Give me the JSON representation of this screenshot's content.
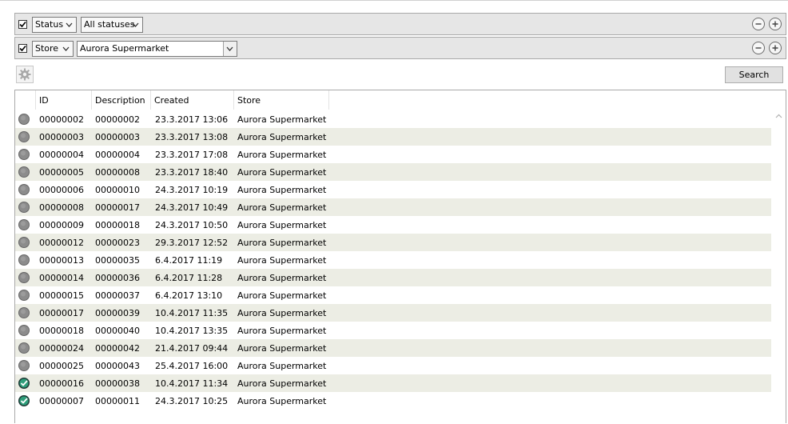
{
  "filters": [
    {
      "checked": true,
      "field": "Status",
      "value": "All statuses"
    },
    {
      "checked": true,
      "field": "Store",
      "value": "Aurora Supermarket"
    }
  ],
  "search": {
    "label": "Search"
  },
  "table": {
    "columns": [
      "ID",
      "Description",
      "Created",
      "Store"
    ],
    "rows": [
      {
        "status": "pending",
        "id": "00000002",
        "description": "00000002",
        "created": "23.3.2017 13:06",
        "store": "Aurora Supermarket"
      },
      {
        "status": "pending",
        "id": "00000003",
        "description": "00000003",
        "created": "23.3.2017 13:08",
        "store": "Aurora Supermarket"
      },
      {
        "status": "pending",
        "id": "00000004",
        "description": "00000004",
        "created": "23.3.2017 17:08",
        "store": "Aurora Supermarket"
      },
      {
        "status": "pending",
        "id": "00000005",
        "description": "00000008",
        "created": "23.3.2017 18:40",
        "store": "Aurora Supermarket"
      },
      {
        "status": "pending",
        "id": "00000006",
        "description": "00000010",
        "created": "24.3.2017 10:19",
        "store": "Aurora Supermarket"
      },
      {
        "status": "pending",
        "id": "00000008",
        "description": "00000017",
        "created": "24.3.2017 10:49",
        "store": "Aurora Supermarket"
      },
      {
        "status": "pending",
        "id": "00000009",
        "description": "00000018",
        "created": "24.3.2017 10:50",
        "store": "Aurora Supermarket"
      },
      {
        "status": "pending",
        "id": "00000012",
        "description": "00000023",
        "created": "29.3.2017 12:52",
        "store": "Aurora Supermarket"
      },
      {
        "status": "pending",
        "id": "00000013",
        "description": "00000035",
        "created": "6.4.2017 11:19",
        "store": "Aurora Supermarket"
      },
      {
        "status": "pending",
        "id": "00000014",
        "description": "00000036",
        "created": "6.4.2017 11:28",
        "store": "Aurora Supermarket"
      },
      {
        "status": "pending",
        "id": "00000015",
        "description": "00000037",
        "created": "6.4.2017 13:10",
        "store": "Aurora Supermarket"
      },
      {
        "status": "pending",
        "id": "00000017",
        "description": "00000039",
        "created": "10.4.2017 11:35",
        "store": "Aurora Supermarket"
      },
      {
        "status": "pending",
        "id": "00000018",
        "description": "00000040",
        "created": "10.4.2017 13:35",
        "store": "Aurora Supermarket"
      },
      {
        "status": "pending",
        "id": "00000024",
        "description": "00000042",
        "created": "21.4.2017 09:44",
        "store": "Aurora Supermarket"
      },
      {
        "status": "pending",
        "id": "00000025",
        "description": "00000043",
        "created": "25.4.2017 16:00",
        "store": "Aurora Supermarket"
      },
      {
        "status": "completed",
        "id": "00000016",
        "description": "00000038",
        "created": "10.4.2017 11:34",
        "store": "Aurora Supermarket"
      },
      {
        "status": "completed",
        "id": "00000007",
        "description": "00000011",
        "created": "24.3.2017 10:25",
        "store": "Aurora Supermarket"
      }
    ]
  },
  "colors": {
    "row_alt": "#ecede4",
    "status_pending": "#8c8c8c",
    "status_completed": "#2e9e7a"
  },
  "icons": {
    "checkbox": "check-icon",
    "remove": "minus-circle-icon",
    "add": "plus-circle-icon",
    "settings": "gear-icon",
    "pending": "grey-dot-icon",
    "completed": "green-check-icon"
  }
}
